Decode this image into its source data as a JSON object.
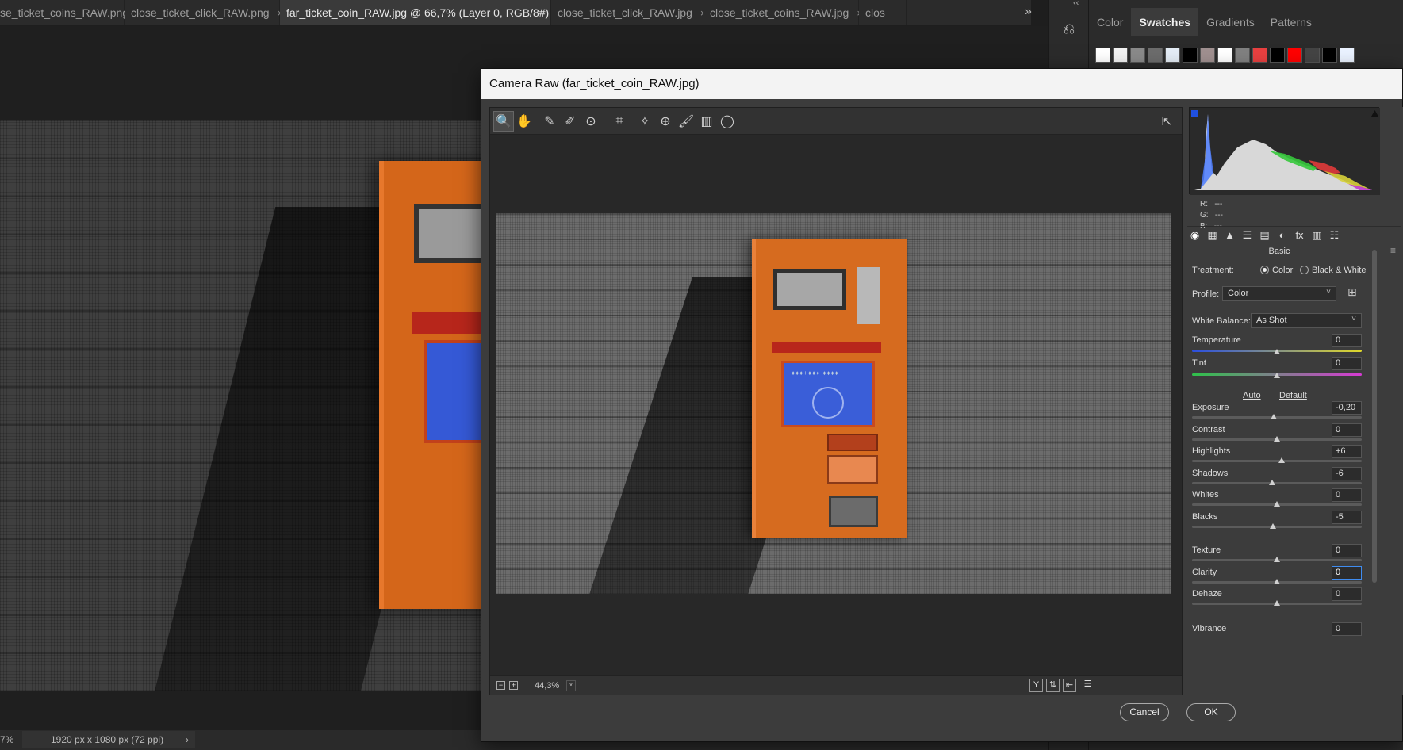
{
  "doc_tabs": [
    {
      "label": "se_ticket_coins_RAW.png",
      "active": false
    },
    {
      "label": "close_ticket_click_RAW.png",
      "active": false
    },
    {
      "label": "far_ticket_coin_RAW.jpg @ 66,7% (Layer 0, RGB/8#) *",
      "active": true
    },
    {
      "label": "close_ticket_click_RAW.jpg",
      "active": false
    },
    {
      "label": "close_ticket_coins_RAW.jpg",
      "active": false
    },
    {
      "label": "clos",
      "active": false
    }
  ],
  "tab_close_glyph": "×",
  "tab_more_glyph": "»",
  "status": {
    "zoom": "7%",
    "doc_info": "1920 px x 1080 px (72 ppi)",
    "chevron": "›"
  },
  "panels": {
    "tabs": [
      {
        "label": "Color",
        "active": false
      },
      {
        "label": "Swatches",
        "active": true
      },
      {
        "label": "Gradients",
        "active": false
      },
      {
        "label": "Patterns",
        "active": false
      }
    ],
    "swatches": [
      "#ffffff",
      "#f2f2f2",
      "#8a8a8a",
      "#6c6c6c",
      "#e4ecf5",
      "#000000",
      "#a09090",
      "#ffffff",
      "#808080",
      "#e84040",
      "#000000",
      "#ff0000",
      "#444444",
      "#000000",
      "#eaf2ff"
    ],
    "collapse_glyph": "‹‹"
  },
  "camera_raw": {
    "title": "Camera Raw (far_ticket_coin_RAW.jpg)",
    "tools": [
      {
        "name": "zoom-tool",
        "glyph": "🔍"
      },
      {
        "name": "hand-tool",
        "glyph": "✋"
      },
      {
        "name": "white-balance-tool",
        "glyph": "✎"
      },
      {
        "name": "color-sampler-tool",
        "glyph": "✐"
      },
      {
        "name": "targeted-adjustment-tool",
        "glyph": "⊙"
      },
      {
        "name": "crop-tool",
        "glyph": "⌗"
      },
      {
        "name": "spot-removal-tool",
        "glyph": "✧"
      },
      {
        "name": "red-eye-tool",
        "glyph": "⊕"
      },
      {
        "name": "adjustment-brush-tool",
        "glyph": "🖌"
      },
      {
        "name": "graduated-filter-tool",
        "glyph": "▥"
      },
      {
        "name": "radial-filter-tool",
        "glyph": "◯"
      }
    ],
    "export_glyph": "⇱",
    "screen_text": "♦♦♦+♦♦♦ ♦♦♦♦",
    "zoom": {
      "minus": "−",
      "plus": "+",
      "value": "44,3%",
      "chevron": "˅"
    },
    "view_buttons": [
      "Y",
      "⇅",
      "⇤",
      "☰"
    ],
    "rgb": {
      "r_label": "R:",
      "g_label": "G:",
      "b_label": "B:",
      "r": "---",
      "g": "---",
      "b": "---"
    },
    "panel_icons": [
      "◉",
      "▦",
      "▲",
      "☰",
      "▤",
      "◐",
      "fx",
      "▥",
      "☷"
    ],
    "panel_title": "Basic",
    "panel_menu": "≡",
    "treatment": {
      "label": "Treatment:",
      "color": "Color",
      "bw": "Black & White",
      "selected": "color"
    },
    "profile": {
      "label": "Profile:",
      "value": "Color",
      "browser_glyph": "⊞"
    },
    "white_balance": {
      "label": "White Balance:",
      "value": "As Shot"
    },
    "temperature": {
      "label": "Temperature",
      "value": "0",
      "position": 0.5
    },
    "tint": {
      "label": "Tint",
      "value": "0",
      "position": 0.5
    },
    "auto": "Auto",
    "default": "Default",
    "sliders": [
      {
        "label": "Exposure",
        "value": "-0,20",
        "position": 0.48
      },
      {
        "label": "Contrast",
        "value": "0",
        "position": 0.5
      },
      {
        "label": "Highlights",
        "value": "+6",
        "position": 0.53
      },
      {
        "label": "Shadows",
        "value": "-6",
        "position": 0.47
      },
      {
        "label": "Whites",
        "value": "0",
        "position": 0.5
      },
      {
        "label": "Blacks",
        "value": "-5",
        "position": 0.475
      }
    ],
    "sliders2": [
      {
        "label": "Texture",
        "value": "0",
        "position": 0.5
      },
      {
        "label": "Clarity",
        "value": "0",
        "position": 0.5,
        "focus": true
      },
      {
        "label": "Dehaze",
        "value": "0",
        "position": 0.5
      }
    ],
    "vibrance": {
      "label": "Vibrance",
      "value": "0"
    },
    "cancel": "Cancel",
    "ok": "OK"
  }
}
